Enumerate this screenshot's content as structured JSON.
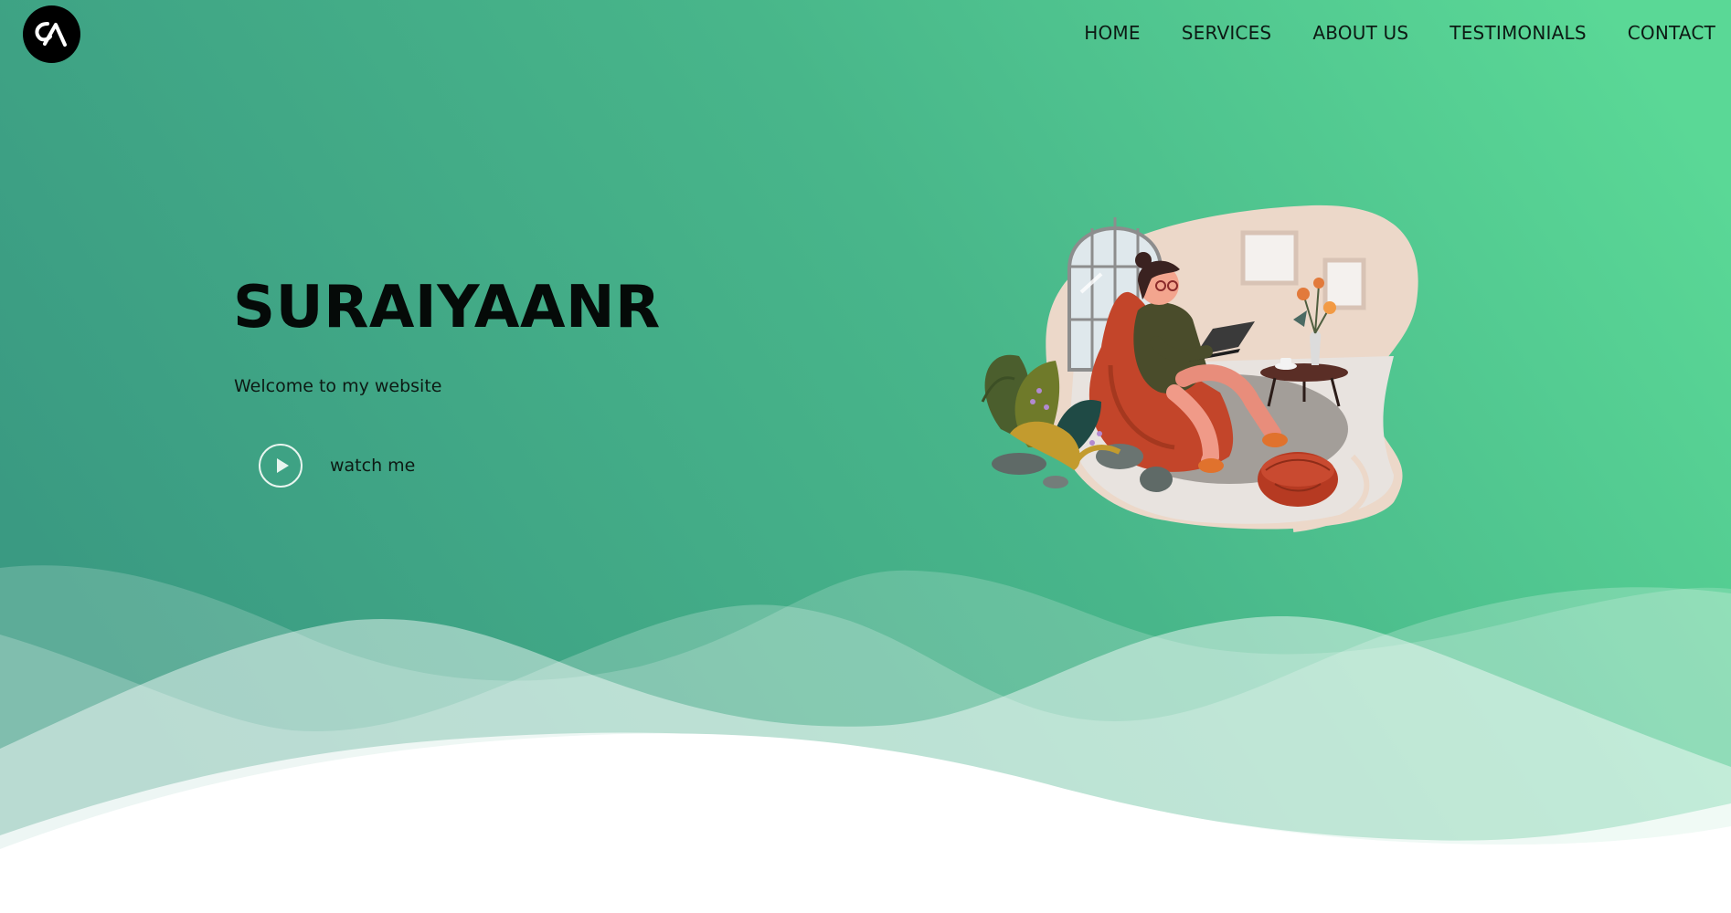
{
  "brand": {
    "logo_text": "SA",
    "logo_icon": "logo-icon"
  },
  "nav": {
    "items": [
      {
        "label": "HOME"
      },
      {
        "label": "SERVICES"
      },
      {
        "label": "ABOUT US"
      },
      {
        "label": "TESTIMONIALS"
      },
      {
        "label": "CONTACT"
      }
    ]
  },
  "hero": {
    "title": "SURAIYAANR",
    "subtitle": "Welcome to my website",
    "watch_label": "watch me",
    "play_icon": "play-icon",
    "illustration": "woman-on-beanbag-with-laptop-illustration"
  },
  "colors": {
    "gradient_start": "#3a9a82",
    "gradient_end": "#5ad896",
    "text_dark": "#0d1a14",
    "white": "#ffffff"
  }
}
